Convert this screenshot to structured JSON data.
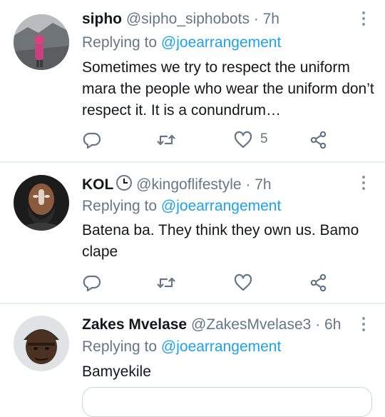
{
  "tweets": [
    {
      "name": "sipho",
      "handle": "@sipho_siphobots",
      "time": "· 7h",
      "replying_prefix": "Replying to",
      "replying_to": "@joearrangement",
      "text": "Sometimes we try to respect the uniform mara the people who wear the uniform don’t respect it. It is a conundrum…",
      "like_count": "5"
    },
    {
      "name": "KOL",
      "name_emoji": "clock-emoji",
      "handle": "@kingoflifestyle",
      "time": "· 7h",
      "replying_prefix": "Replying to",
      "replying_to": "@joearrangement",
      "text": "Batena ba. They think they own us.  Bamo clape",
      "like_count": ""
    },
    {
      "name": "Zakes Mvelase",
      "handle": "@ZakesMvelase3",
      "time": "· 6h",
      "replying_prefix": "Replying to",
      "replying_to": "@joearrangement",
      "text": "Bamyekile"
    }
  ],
  "colors": {
    "accent": "#1da1f2",
    "secondary_text": "#657786",
    "icon": "#657786",
    "divider": "#e6ecf0"
  },
  "icons": [
    "reply-icon",
    "retweet-icon",
    "like-icon",
    "share-icon",
    "more-icon"
  ]
}
